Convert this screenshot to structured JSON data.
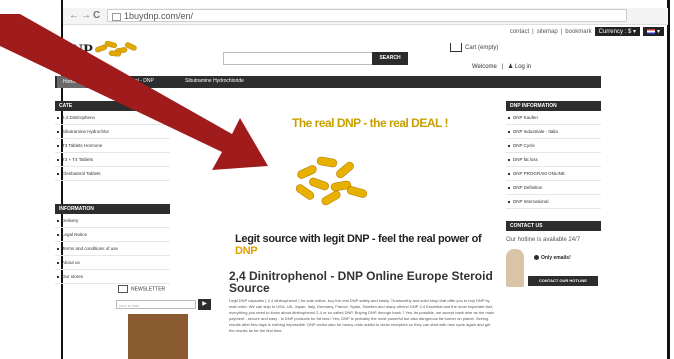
{
  "browser": {
    "back": "←",
    "forward": "→",
    "reload": "C",
    "url": "1buydnp.com/en/"
  },
  "toplinks": {
    "contact": "contact",
    "sep": "|",
    "sitemap": "sitemap",
    "bookmark": "bookmark",
    "currency": "Currency : $ ▾",
    "lang": "▾"
  },
  "header": {
    "logo": "DNP",
    "search_button": "SEARCH",
    "cart": "Cart (empty)",
    "welcome": "Welcome",
    "separator": "|",
    "login": "Log in"
  },
  "menu": {
    "items": [
      "Home ▾",
      "2,4 Dinitrophenol - DNP",
      "Sibutramine Hydrochloride"
    ]
  },
  "categories": {
    "title": "CATE",
    "items": [
      "2,4 Dinitropheno",
      "Sibutramine Hydrochlor",
      "T3 Tablets Hormone",
      "T3 + T4 Tablets",
      "Clenbuterol Tablets"
    ]
  },
  "information": {
    "title": "INFORMATION",
    "items": [
      "Delivery",
      "Legal Notice",
      "Terms and conditions of use",
      "About us",
      "Our stores"
    ]
  },
  "newsletter": {
    "title": "NEWSLETTER",
    "placeholder": "your e-mail",
    "button": "▶"
  },
  "banner": {
    "title": "The real DNP - the real DEAL !",
    "subtitle_main": "Legit source with legit DNP - feel the real power of ",
    "subtitle_brand": "DNP"
  },
  "main": {
    "headline": "2,4 Dinitrophenol - DNP Online Europe Steroid Source",
    "paragraph": "Legit DNP capsules ( 2,4 dinitrophenol ) for sale online, buy the real DNP safely and easily. Trustworthy and solid shop that offer you to buy DNP by mail order. We can ship to USA, UK, Japan, Italy, Germany, France, Spain, Sweden and many others! DNP 2,4 Essential and the most important fact, everything you need to know about dinitrophenol 2-4 or so called DNP. Buying DNP through bank ? Yes, its possible, we accept bank wire as the main payment - secure and easy . Is DNP products for fat loss? Yes, DNP is probably the most powerful but also dangerous fat burner on planet. Seeing results after few days is nothing impossible. DNP works also for heavy roids addict to clean receptors so they can start with new cycle again and get the results as for the first time."
  },
  "dnp_info": {
    "title": "DNP INFORMATION",
    "items": [
      "DNP Kaufen",
      "DNP Industriale - Italia",
      "DNP Cycle",
      "DNP fat loss",
      "DNP PROGRAM ONLINE",
      "DNP Definition",
      "DNP International"
    ]
  },
  "contact": {
    "title": "CONTACT US",
    "hotline": "Our hotline is available 24/7",
    "email": "Only emails!",
    "button": "CONTACT OUR HOTLINE"
  },
  "colors": {
    "dark_bar": "#2d2d2d",
    "banner_gold": "#c8a000",
    "arrow_red": "#a01c1c"
  }
}
